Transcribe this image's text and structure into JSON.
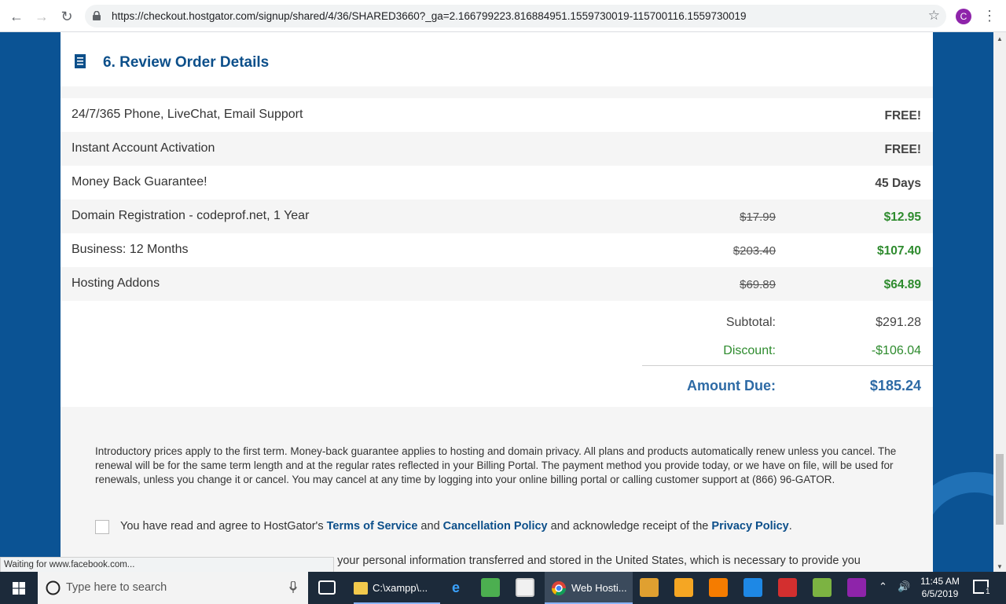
{
  "browser": {
    "url": "https://checkout.hostgator.com/signup/shared/4/36/SHARED3660?_ga=2.166799223.816884951.1559730019-115700116.1559730019",
    "avatar_letter": "C"
  },
  "section": {
    "title": "6. Review Order Details"
  },
  "order_items": [
    {
      "label": "24/7/365 Phone, LiveChat, Email Support",
      "old_price": "",
      "price": "FREE!"
    },
    {
      "label": "Instant Account Activation",
      "old_price": "",
      "price": "FREE!"
    },
    {
      "label": "Money Back Guarantee!",
      "old_price": "",
      "price": "45 Days"
    },
    {
      "label": "Domain Registration - codeprof.net, 1 Year",
      "old_price": "$17.99",
      "price": "$12.95"
    },
    {
      "label": "Business: 12 Months",
      "old_price": "$203.40",
      "price": "$107.40"
    },
    {
      "label": "Hosting Addons",
      "old_price": "$69.89",
      "price": "$64.89"
    }
  ],
  "totals": {
    "subtotal_label": "Subtotal:",
    "subtotal_value": "$291.28",
    "discount_label": "Discount:",
    "discount_value": "-$106.04",
    "amount_due_label": "Amount Due:",
    "amount_due_value": "$185.24"
  },
  "disclaimer": "Introductory prices apply to the first term. Money-back guarantee applies to hosting and domain privacy. All plans and products automatically renew unless you cancel. The renewal will be for the same term length and at the regular rates reflected in your Billing Portal. The payment method you provide today, or we have on file, will be used for renewals, unless you change it or cancel. You may cancel at any time by logging into your online billing portal or calling customer support at (866) 96-GATOR.",
  "agreement": {
    "prefix": "You have read and agree to HostGator's ",
    "tos_link": "Terms of Service",
    "and": " and ",
    "cancel_link": "Cancellation Policy",
    "middle": " and acknowledge receipt of the ",
    "privacy_link": "Privacy Policy",
    "suffix": "."
  },
  "cut_off_text": "e your personal information transferred and stored in the United States, which is necessary to provide you",
  "status_bar": "Waiting for www.facebook.com...",
  "taskbar": {
    "search_placeholder": "Type here to search",
    "explorer_label": "C:\\xampp\\...",
    "chrome_label": "Web Hosti...",
    "time": "11:45 AM",
    "date": "6/5/2019",
    "notification_count": "1"
  },
  "colors": {
    "page_bg": "#0b5394",
    "accent_blue": "#0c4f8a",
    "price_green": "#2e8b2e",
    "amount_due": "#2d6aa5"
  }
}
